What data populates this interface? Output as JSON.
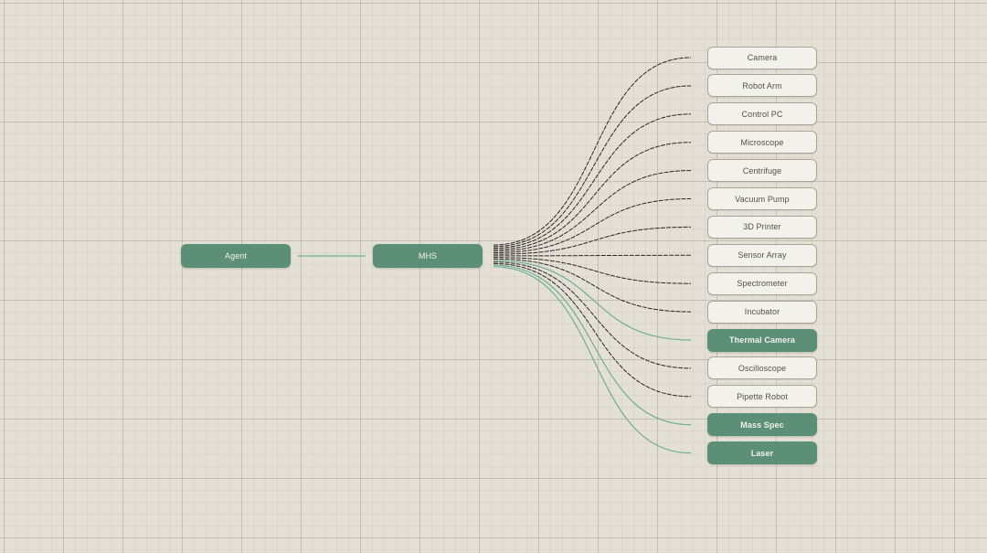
{
  "nodes": {
    "agent": {
      "label": "Agent"
    },
    "hub": {
      "label": "MHS"
    }
  },
  "colors": {
    "accent": "#5b8f77",
    "link_dark": "#2a2826",
    "link_accent": "#6fae94",
    "node_light": "#f3f1ec"
  },
  "targets": [
    {
      "label": "Camera",
      "highlight": false
    },
    {
      "label": "Robot Arm",
      "highlight": false
    },
    {
      "label": "Control PC",
      "highlight": false
    },
    {
      "label": "Microscope",
      "highlight": false
    },
    {
      "label": "Centrifuge",
      "highlight": false
    },
    {
      "label": "Vacuum Pump",
      "highlight": false
    },
    {
      "label": "3D Printer",
      "highlight": false
    },
    {
      "label": "Sensor Array",
      "highlight": false
    },
    {
      "label": "Spectrometer",
      "highlight": false
    },
    {
      "label": "Incubator",
      "highlight": false
    },
    {
      "label": "Thermal Camera",
      "highlight": true
    },
    {
      "label": "Oscilloscope",
      "highlight": false
    },
    {
      "label": "Pipette Robot",
      "highlight": false
    },
    {
      "label": "Mass Spec",
      "highlight": true
    },
    {
      "label": "Laser",
      "highlight": true
    }
  ]
}
